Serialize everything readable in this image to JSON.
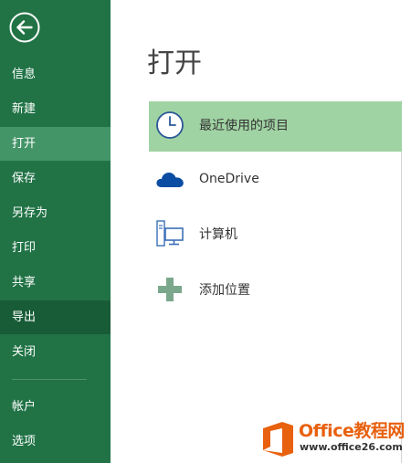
{
  "colors": {
    "sidebar_bg": "#217346",
    "sidebar_active": "#439467",
    "sidebar_hover": "#185c37",
    "selected_place_bg": "#a0d3a3",
    "watermark_orange": "#e8610f"
  },
  "sidebar": {
    "back_icon": "back-arrow-icon",
    "items": [
      {
        "label": "信息"
      },
      {
        "label": "新建"
      },
      {
        "label": "打开",
        "state": "active"
      },
      {
        "label": "保存"
      },
      {
        "label": "另存为"
      },
      {
        "label": "打印"
      },
      {
        "label": "共享"
      },
      {
        "label": "导出",
        "state": "hover"
      },
      {
        "label": "关闭"
      },
      {
        "label": "帐户"
      },
      {
        "label": "选项"
      }
    ]
  },
  "main": {
    "title": "打开",
    "places": [
      {
        "label": "最近使用的项目",
        "icon": "clock-icon",
        "selected": true
      },
      {
        "label": "OneDrive",
        "icon": "cloud-icon"
      },
      {
        "label": "计算机",
        "icon": "computer-icon"
      },
      {
        "label": "添加位置",
        "icon": "plus-icon"
      }
    ]
  },
  "watermark": {
    "title": "Office教程网",
    "url": "www.office26.com",
    "icon": "office-logo-icon"
  }
}
